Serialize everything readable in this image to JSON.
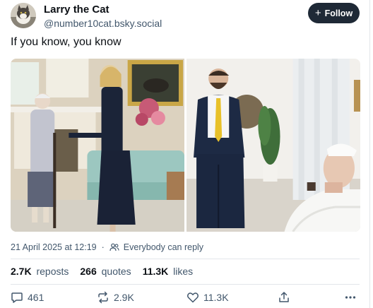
{
  "author": {
    "display_name": "Larry the Cat",
    "handle": "@number10cat.bsky.social",
    "avatar_icon": "cat-avatar"
  },
  "follow_button": {
    "label": "Follow",
    "icon": "plus-icon"
  },
  "post": {
    "text": "If you know, you know",
    "images": [
      {
        "description_icon": "photo-left"
      },
      {
        "description_icon": "photo-right"
      }
    ],
    "timestamp": "21 April 2025 at 12:19",
    "reply_setting": "Everybody can reply"
  },
  "stats": {
    "reposts_count": "2.7K",
    "reposts_label": "reposts",
    "quotes_count": "266",
    "quotes_label": "quotes",
    "likes_count": "11.3K",
    "likes_label": "likes"
  },
  "actions": {
    "reply_count": "461",
    "repost_count": "2.9K",
    "like_count": "11.3K"
  },
  "colors": {
    "follow_bg": "#1e2936",
    "muted_text": "#42576c",
    "divider": "#e3e6ea"
  }
}
